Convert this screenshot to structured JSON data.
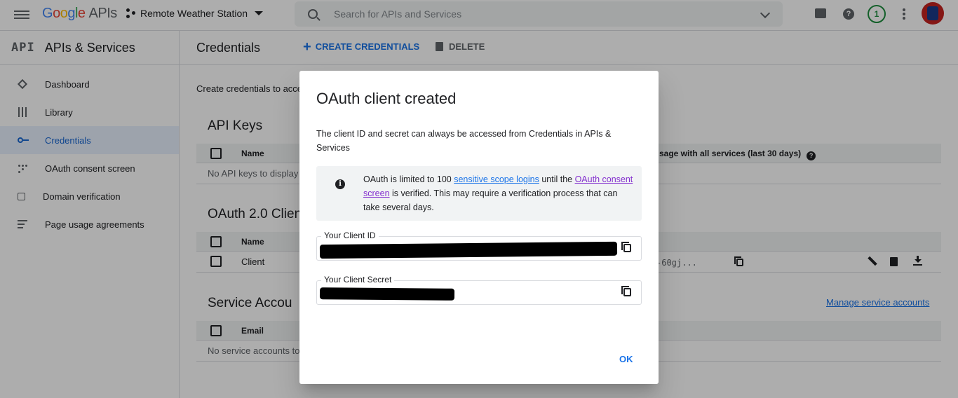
{
  "topbar": {
    "logo_google": "Google",
    "logo_apis": "APIs",
    "project_name": "Remote Weather Station",
    "search_placeholder": "Search for APIs and Services",
    "notification_count": "1",
    "help_glyph": "?"
  },
  "sidebar": {
    "api_badge": "API",
    "title": "APIs & Services",
    "items": [
      {
        "label": "Dashboard",
        "icon": "dashboard-icon"
      },
      {
        "label": "Library",
        "icon": "library-icon"
      },
      {
        "label": "Credentials",
        "icon": "key-icon",
        "active": true
      },
      {
        "label": "OAuth consent screen",
        "icon": "oauth-consent-icon"
      },
      {
        "label": "Domain verification",
        "icon": "domain-verification-icon"
      },
      {
        "label": "Page usage agreements",
        "icon": "page-usage-icon"
      }
    ]
  },
  "main": {
    "page_title": "Credentials",
    "create_label": "CREATE CREDENTIALS",
    "delete_label": "DELETE",
    "intro_text": "Create credentials to acce",
    "api_keys": {
      "title": "API Keys",
      "col_name": "Name",
      "col_usage": "sage with all services (last 30 days)",
      "empty": "No API keys to display"
    },
    "oauth": {
      "title": "OAuth 2.0 Clien",
      "col_name": "Name",
      "row_name": "Client",
      "row_client_id": "-60gj..."
    },
    "service_accounts": {
      "title": "Service Accou",
      "col_email": "Email",
      "empty": "No service accounts to",
      "manage_link": "Manage service accounts"
    }
  },
  "dialog": {
    "title": "OAuth client created",
    "description": "The client ID and secret can always be accessed from Credentials in APIs & Services",
    "info": {
      "text_1": "OAuth is limited to 100 ",
      "link_1": "sensitive scope logins",
      "text_2": " until the ",
      "link_2": "OAuth consent screen",
      "text_3": " is verified. This may require a verification process that can take several days."
    },
    "client_id_label": "Your Client ID",
    "client_secret_label": "Your Client Secret",
    "ok_label": "OK"
  },
  "colors": {
    "accent": "#1a73e8",
    "active_bg": "#e8f0fe",
    "visited_link": "#8430ce",
    "scrim": "rgba(0,0,0,0.32)"
  }
}
